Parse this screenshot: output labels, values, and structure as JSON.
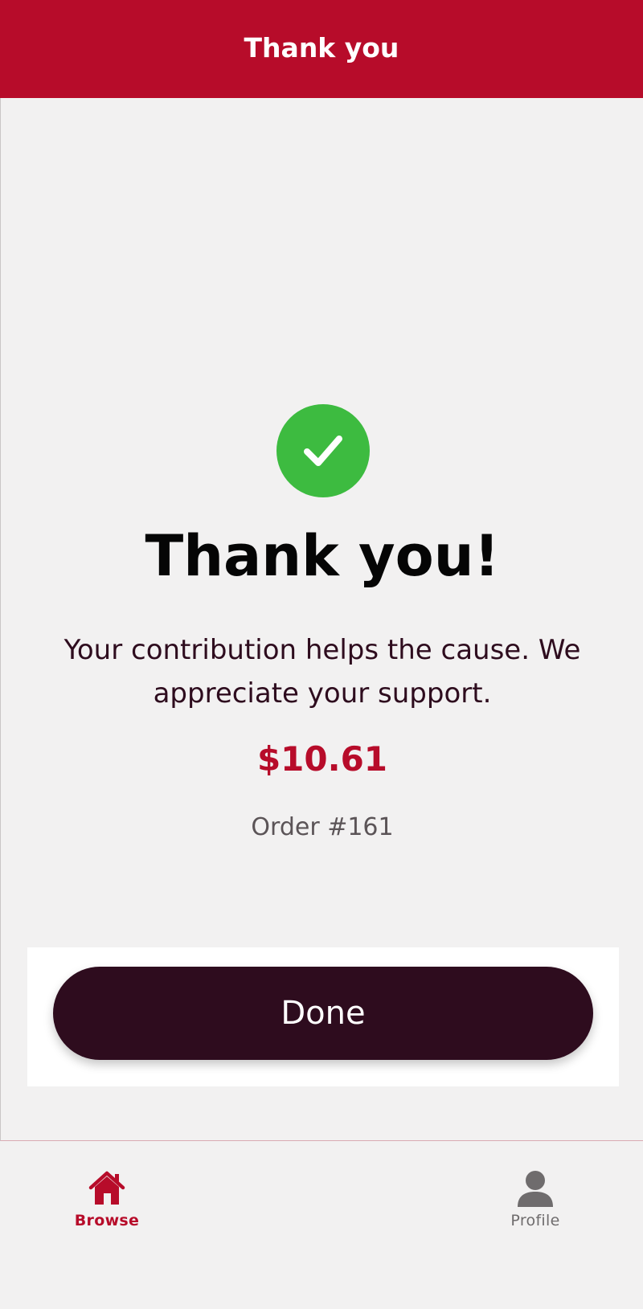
{
  "header": {
    "title": "Thank you"
  },
  "confirmation": {
    "icon": "check-circle-icon",
    "heading": "Thank you!",
    "message": "Your contribution helps the cause. We appreciate your support.",
    "amount": "$10.61",
    "order": "Order #161"
  },
  "actions": {
    "done_label": "Done"
  },
  "tabbar": {
    "items": [
      {
        "label": "Browse",
        "icon": "home-icon",
        "active": true
      },
      {
        "label": "Profile",
        "icon": "person-icon",
        "active": false
      }
    ]
  },
  "colors": {
    "brand": "#b70c2a",
    "dark": "#2e0c1e",
    "success": "#3dbb40"
  }
}
